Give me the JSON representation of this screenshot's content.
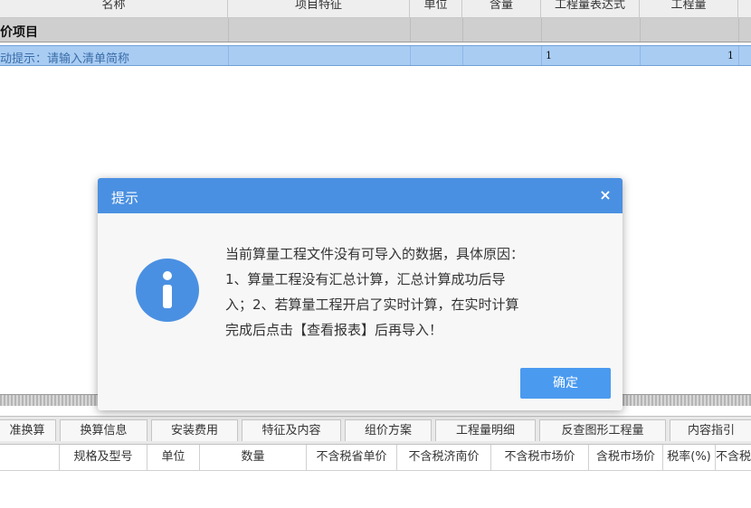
{
  "grid": {
    "columns": [
      "名称",
      "项目特征",
      "单位",
      "含量",
      "工程量表达式",
      "工程量"
    ],
    "section_title": "价项目",
    "input_row": {
      "hint": "动提示：请输入清单简称",
      "expression": "1",
      "quantity": "1"
    }
  },
  "dialog": {
    "title": "提示",
    "close_symbol": "×",
    "message_lines": [
      "当前算量工程文件没有可导入的数据，具体原因：",
      "1、算量工程没有汇总计算，汇总计算成功后导",
      "入；2、若算量工程开启了实时计算，在实时计算",
      "完成后点击【查看报表】后再导入！"
    ],
    "icon": "info-icon",
    "ok_label": "确定",
    "accent": "#4a90e2"
  },
  "bottom": {
    "tabs": [
      "准换算",
      "换算信息",
      "安装费用",
      "特征及内容",
      "组价方案",
      "工程量明细",
      "反查图形工程量",
      "内容指引"
    ],
    "columns": [
      "规格及型号",
      "单位",
      "数量",
      "不含税省单价",
      "不含税济南价",
      "不含税市场价",
      "含税市场价",
      "税率(%)",
      "不含税"
    ]
  }
}
